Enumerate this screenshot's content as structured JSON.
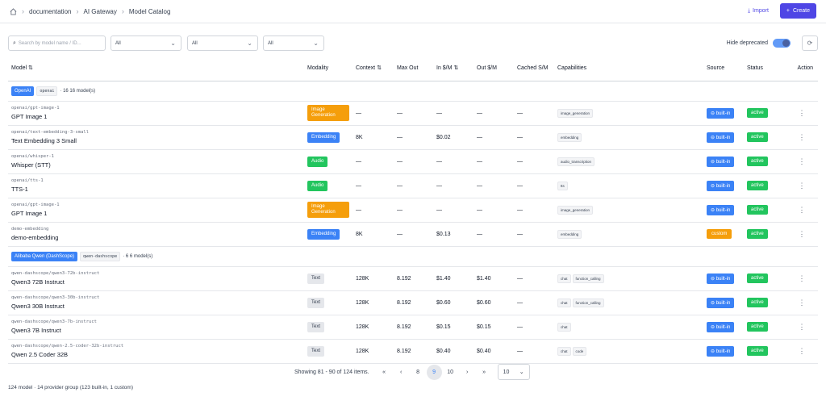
{
  "breadcrumb": {
    "items": [
      "documentation",
      "AI Gateway",
      "Model Catalog"
    ]
  },
  "header": {
    "import_label": "Import",
    "create_label": "Create"
  },
  "filters": {
    "search_placeholder": "Search by model name / ID...",
    "select1": "All",
    "select2": "All",
    "select3": "All",
    "hide_deprecated_label": "Hide deprecated"
  },
  "columns": {
    "model": "Model",
    "modality": "Modality",
    "context": "Context",
    "max_out": "Max Out",
    "in_cost": "In $/M",
    "out_cost": "Out $/M",
    "cached": "Cached S/M",
    "capabilities": "Capabilities",
    "source": "Source",
    "status": "Status",
    "action": "Action"
  },
  "groups": [
    {
      "badge": "OpenAI",
      "code": "openai",
      "count": "· 16 16 model(s)",
      "rows": [
        {
          "id": "openai/gpt-image-1",
          "name": "GPT Image 1",
          "modality": "Image Generation",
          "mtype": "img",
          "context": "—",
          "max_out": "—",
          "in": "—",
          "out": "—",
          "cached": "—",
          "caps": [
            "image_generation"
          ],
          "source": "built-in",
          "status": "active"
        },
        {
          "id": "openai/text-embedding-3-small",
          "name": "Text Embedding 3 Small",
          "modality": "Embedding",
          "mtype": "emb",
          "context": "8K",
          "max_out": "—",
          "in": "$0.02",
          "out": "—",
          "cached": "—",
          "caps": [
            "embedding"
          ],
          "source": "built-in",
          "status": "active"
        },
        {
          "id": "openai/whisper-1",
          "name": "Whisper (STT)",
          "modality": "Audio",
          "mtype": "aud",
          "context": "—",
          "max_out": "—",
          "in": "—",
          "out": "—",
          "cached": "—",
          "caps": [
            "audio_transcription"
          ],
          "source": "built-in",
          "status": "active"
        },
        {
          "id": "openai/tts-1",
          "name": "TTS-1",
          "modality": "Audio",
          "mtype": "aud",
          "context": "—",
          "max_out": "—",
          "in": "—",
          "out": "—",
          "cached": "—",
          "caps": [
            "tts"
          ],
          "source": "built-in",
          "status": "active"
        },
        {
          "id": "openai/gpt-image-1",
          "name": "GPT Image 1",
          "modality": "Image Generation",
          "mtype": "img",
          "context": "—",
          "max_out": "—",
          "in": "—",
          "out": "—",
          "cached": "—",
          "caps": [
            "image_generation"
          ],
          "source": "built-in",
          "status": "active"
        },
        {
          "id": "demo-embedding",
          "name": "demo-embedding",
          "modality": "Embedding",
          "mtype": "emb",
          "context": "8K",
          "max_out": "—",
          "in": "$0.13",
          "out": "—",
          "cached": "—",
          "caps": [
            "embedding"
          ],
          "source": "custom",
          "status": "active"
        }
      ]
    },
    {
      "badge": "Alibaba Qwen (DashScope)",
      "code": "qwen-dashscope",
      "count": "· 6 6 model(s)",
      "rows": [
        {
          "id": "qwen-dashscope/qwen3-72b-instruct",
          "name": "Qwen3 72B Instruct",
          "modality": "Text",
          "mtype": "txt",
          "context": "128K",
          "max_out": "8.192",
          "in": "$1.40",
          "out": "$1.40",
          "cached": "—",
          "caps": [
            "chat",
            "function_calling"
          ],
          "source": "built-in",
          "status": "active"
        },
        {
          "id": "qwen-dashscope/qwen3-30b-instruct",
          "name": "Qwen3 30B Instruct",
          "modality": "Text",
          "mtype": "txt",
          "context": "128K",
          "max_out": "8.192",
          "in": "$0.60",
          "out": "$0.60",
          "cached": "—",
          "caps": [
            "chat",
            "function_calling"
          ],
          "source": "built-in",
          "status": "active"
        },
        {
          "id": "qwen-dashscope/qwen3-7b-instruct",
          "name": "Qwen3 7B Instruct",
          "modality": "Text",
          "mtype": "txt",
          "context": "128K",
          "max_out": "8.192",
          "in": "$0.15",
          "out": "$0.15",
          "cached": "—",
          "caps": [
            "chat"
          ],
          "source": "built-in",
          "status": "active"
        },
        {
          "id": "qwen-dashscope/qwen-2.5-coder-32b-instruct",
          "name": "Qwen 2.5 Coder 32B",
          "modality": "Text",
          "mtype": "txt",
          "context": "128K",
          "max_out": "8.192",
          "in": "$0.40",
          "out": "$0.40",
          "cached": "—",
          "caps": [
            "chat",
            "code"
          ],
          "source": "built-in",
          "status": "active"
        }
      ]
    }
  ],
  "pagination": {
    "info": "Showing 81 - 90 of 124 items.",
    "first": "«",
    "prev": "‹",
    "pages": [
      "8",
      "9",
      "10"
    ],
    "current": "9",
    "next": "›",
    "last": "»",
    "page_size": "10"
  },
  "footer": "124 model · 14 provider group (123 built-in, 1 custom)"
}
